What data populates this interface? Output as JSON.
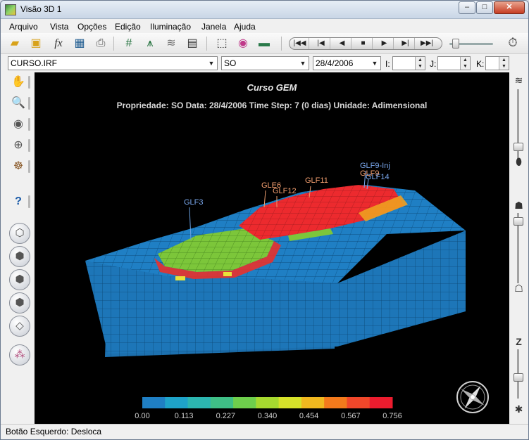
{
  "window": {
    "title": "Visão 3D 1",
    "minimize": "–",
    "maximize": "□",
    "close": "✕"
  },
  "menu": [
    "Arquivo",
    "Vista",
    "Opções",
    "Edição",
    "Iluminação",
    "Janela",
    "Ajuda"
  ],
  "toolbar": {
    "icons": [
      "open-icon",
      "open-folder-icon",
      "function-icon",
      "save-icon",
      "print-icon",
      "grid-icon",
      "well-icon",
      "wave-icon",
      "fault-icon",
      "select-box-icon",
      "color-wheel-icon",
      "camera-icon"
    ],
    "player": [
      "|◀◀",
      "|◀",
      "◀",
      "■",
      "▶",
      "▶|",
      "▶▶|"
    ]
  },
  "selection": {
    "file": "CURSO.IRF",
    "property": "SO",
    "date": "28/4/2006",
    "i_label": "I:",
    "j_label": "J:",
    "k_label": "K:",
    "i_value": "",
    "j_value": "",
    "k_value": ""
  },
  "viewport": {
    "title": "Curso GEM",
    "subtitle": "Propriedade: SO  Data: 28/4/2006 Time Step: 7 (0 dias) Unidade: Adimensional",
    "wells": [
      "GLF3",
      "GLE6",
      "GLF12",
      "GLF11",
      "GLF9-Inj",
      "GLF9",
      "GLF14"
    ],
    "colorbar": {
      "ticks": [
        "0.00",
        "0.113",
        "0.227",
        "0.340",
        "0.454",
        "0.567",
        "0.756"
      ],
      "colors": [
        "#1f7fc4",
        "#1ea3c9",
        "#2cb6b0",
        "#3fbf86",
        "#6ecf4c",
        "#a6d92f",
        "#d6e22a",
        "#f0b81f",
        "#f37a1c",
        "#f0472a",
        "#ec1c2e"
      ]
    }
  },
  "status": "Botão Esquerdo: Desloca"
}
